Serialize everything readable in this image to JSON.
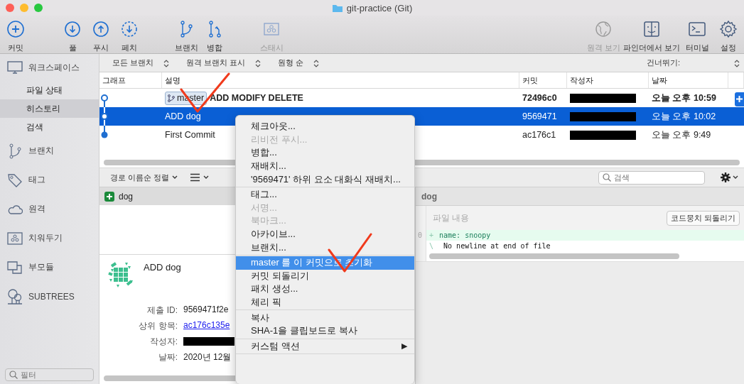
{
  "window": {
    "title": "git-practice (Git)"
  },
  "toolbar": {
    "left": [
      {
        "label": "커밋",
        "kind": "commit",
        "disabled": false
      },
      {
        "label": "풀",
        "kind": "pull",
        "disabled": false
      },
      {
        "label": "푸시",
        "kind": "push",
        "disabled": false
      },
      {
        "label": "페치",
        "kind": "fetch",
        "disabled": false
      },
      {
        "label": "브랜치",
        "kind": "branch",
        "disabled": false
      },
      {
        "label": "병합",
        "kind": "merge",
        "disabled": false
      },
      {
        "label": "스태시",
        "kind": "stash",
        "disabled": true
      }
    ],
    "right": [
      {
        "label": "원격 보기",
        "kind": "remote",
        "disabled": true
      },
      {
        "label": "파인더에서 보기",
        "kind": "finder",
        "disabled": false
      },
      {
        "label": "터미널",
        "kind": "terminal",
        "disabled": false
      },
      {
        "label": "설정",
        "kind": "settings",
        "disabled": false
      }
    ]
  },
  "sidebar": {
    "items": [
      {
        "label": "워크스페이스",
        "kind": "workspace",
        "selected": false,
        "children": [
          {
            "label": "파일 상태",
            "selected": false
          },
          {
            "label": "히스토리",
            "selected": true
          },
          {
            "label": "검색",
            "selected": false
          }
        ]
      },
      {
        "label": "브랜치",
        "kind": "branch",
        "selected": false
      },
      {
        "label": "태그",
        "kind": "tag",
        "selected": false
      },
      {
        "label": "원격",
        "kind": "remote",
        "selected": false
      },
      {
        "label": "치워두기",
        "kind": "stash",
        "selected": false
      },
      {
        "label": "부모듈",
        "kind": "submodule",
        "selected": false
      },
      {
        "label": "SUBTREES",
        "kind": "subtree",
        "selected": false
      }
    ],
    "filter": {
      "placeholder": "필터"
    }
  },
  "filters": [
    {
      "label": "모든 브랜치"
    },
    {
      "label": "원격 브랜치 표시"
    },
    {
      "label": "원형 순"
    }
  ],
  "skip": {
    "label": "건너뛰기:"
  },
  "table": {
    "columns": [
      "그래프",
      "설명",
      "커밋",
      "작성자",
      "날짜"
    ],
    "rows": [
      {
        "branch": "master",
        "description": "ADD MODIFY DELETE",
        "commit": "72496c0",
        "date": "오늘 오후 10:59",
        "head": true,
        "selected": false
      },
      {
        "description": "ADD dog",
        "commit": "9569471",
        "date": "오늘 오후 10:02",
        "head": false,
        "selected": true
      },
      {
        "description": "First Commit",
        "commit": "ac176c1",
        "date": "오늘 오후 9:49",
        "head": false,
        "selected": false
      }
    ]
  },
  "file_toolbar": {
    "sort": "경로 이름순 정렬",
    "search": {
      "placeholder": "검색"
    }
  },
  "files": [
    {
      "name": "dog",
      "selected": true
    }
  ],
  "commit_detail": {
    "message": "ADD dog",
    "fields": [
      {
        "label": "제출 ID:",
        "value": "9569471f2e",
        "kind": "text"
      },
      {
        "label": "상위 항목:",
        "value": "ac176c135e",
        "kind": "link"
      },
      {
        "label": "작성자:",
        "kind": "redacted"
      },
      {
        "label": "날짜:",
        "value": "2020년 12월",
        "kind": "text"
      }
    ]
  },
  "diff": {
    "file": "dog",
    "header": "파일 내용",
    "button": "코드뭉치 되돌리기",
    "lines": [
      {
        "number": "0",
        "marker": "+",
        "text": "name: snoopy",
        "kind": "added"
      },
      {
        "marker": "\\",
        "text": " No newline at end of file",
        "kind": "note"
      }
    ]
  },
  "context_menu": {
    "sections": [
      [
        {
          "label": "체크아웃...",
          "disabled": false,
          "selected": false
        },
        {
          "label": "리비전 푸시...",
          "disabled": true,
          "selected": false
        },
        {
          "label": "병합...",
          "disabled": false,
          "selected": false
        },
        {
          "label": "재배치...",
          "disabled": false,
          "selected": false
        },
        {
          "label": "'9569471' 하위 요소 대화식 재배치...",
          "disabled": false,
          "selected": false
        }
      ],
      [
        {
          "label": "태그...",
          "disabled": false,
          "selected": false
        },
        {
          "label": "서명...",
          "disabled": true,
          "selected": false
        },
        {
          "label": "북마크...",
          "disabled": true,
          "selected": false
        },
        {
          "label": "아카이브...",
          "disabled": false,
          "selected": false
        },
        {
          "label": "브랜치...",
          "disabled": false,
          "selected": false
        }
      ],
      [
        {
          "label": "master 를 이 커밋으로 초기화",
          "disabled": false,
          "selected": true
        },
        {
          "label": "커밋 되돌리기",
          "disabled": false,
          "selected": false
        },
        {
          "label": "패치 생성...",
          "disabled": false,
          "selected": false
        },
        {
          "label": "체리 픽",
          "disabled": false,
          "selected": false
        }
      ],
      [
        {
          "label": "복사",
          "disabled": false,
          "selected": false
        },
        {
          "label": "SHA-1을 클립보드로 복사",
          "disabled": false,
          "selected": false
        }
      ],
      [
        {
          "label": "커스텀 액션",
          "disabled": false,
          "selected": false,
          "arrow": "▶"
        }
      ]
    ]
  }
}
